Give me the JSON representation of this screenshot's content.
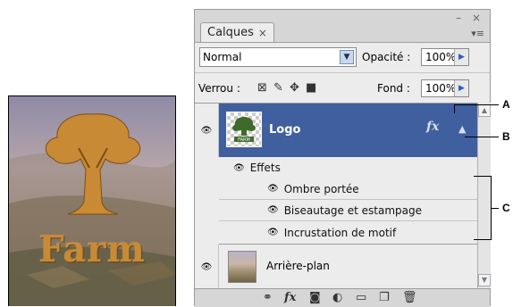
{
  "preview": {
    "word": "Farm"
  },
  "panel": {
    "tab_label": "Calques",
    "tab_close": "×",
    "window_controls": "– ×",
    "panel_menu": "▾≡",
    "blend_mode": "Normal",
    "opacity_label": "Opacité :",
    "opacity_value": "100%",
    "lock_label": "Verrou :",
    "fill_label": "Fond :",
    "fill_value": "100%"
  },
  "layers": {
    "logo": {
      "name": "Logo",
      "fx_badge": "fx",
      "thumb_text": "FARM"
    },
    "effects_label": "Effets",
    "effects": [
      "Ombre portée",
      "Biseautage et estampage",
      "Incrustation de motif"
    ],
    "background": {
      "name": "Arrière-plan"
    }
  },
  "callouts": {
    "a": "A",
    "b": "B",
    "c": "C"
  },
  "icons": {
    "eye": "eye-icon",
    "lock_transparency": "lock-transparency-icon",
    "lock_paint": "lock-paint-icon",
    "lock_move": "lock-move-icon",
    "lock_all": "lock-all-icon",
    "link": "link-layers-icon",
    "fx": "layer-style-icon",
    "mask": "add-mask-icon",
    "adjust": "adjustment-layer-icon",
    "group": "new-group-icon",
    "new_layer": "new-layer-icon",
    "delete": "trash-icon"
  }
}
